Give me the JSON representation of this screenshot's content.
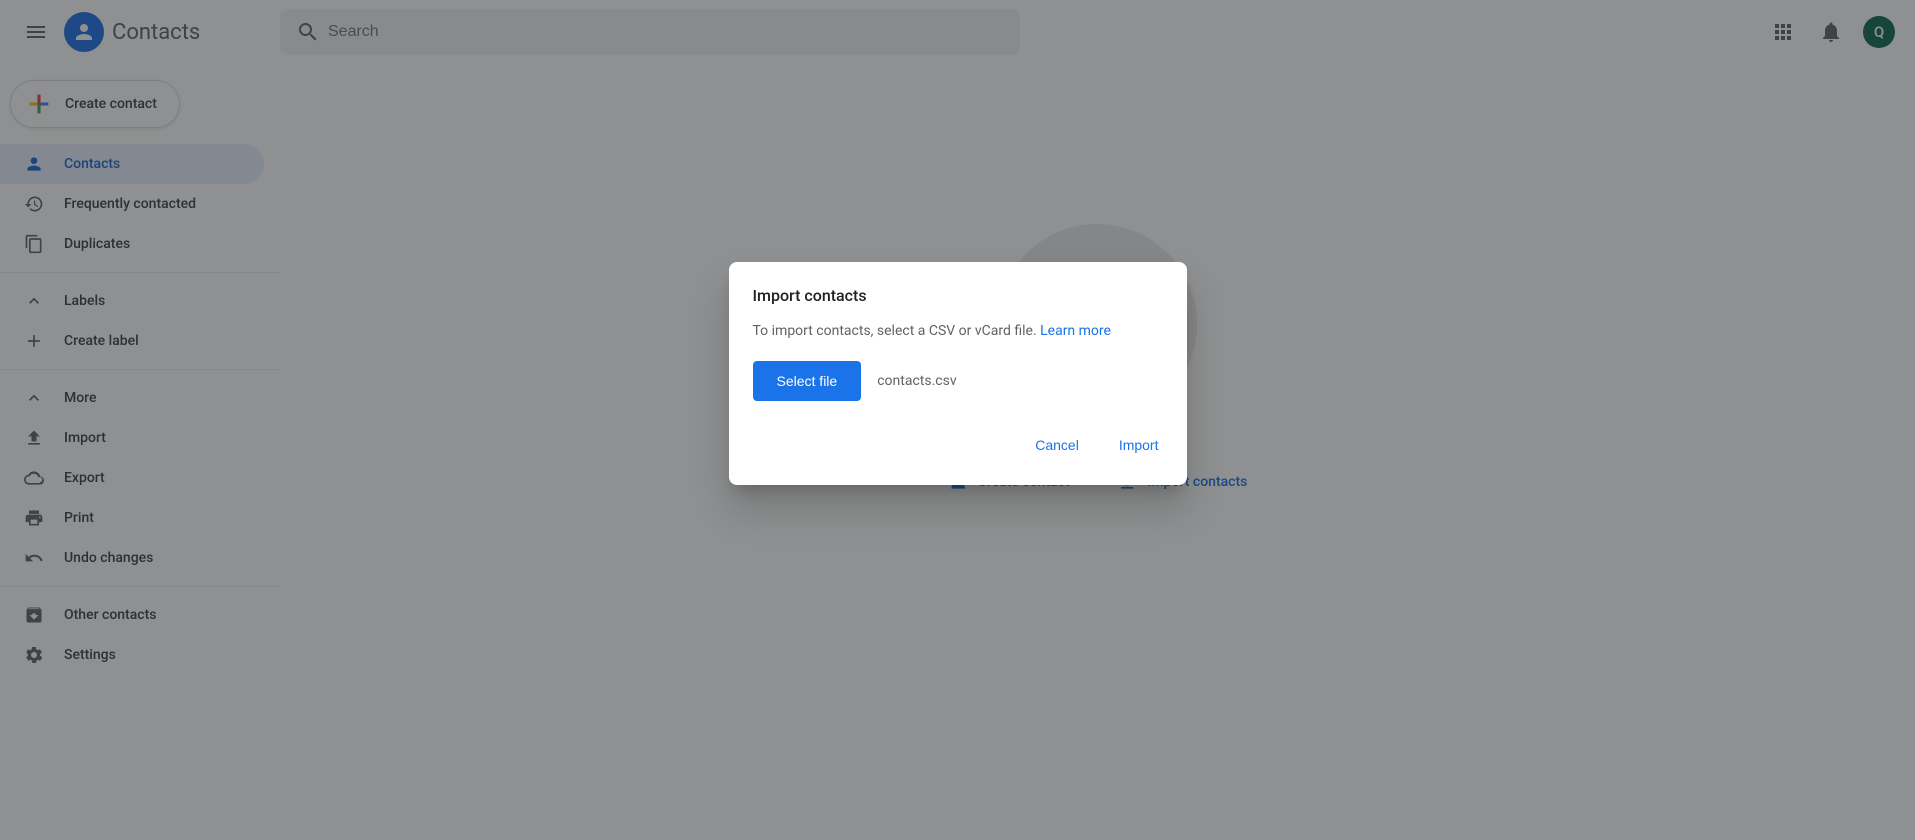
{
  "header": {
    "app_title": "Contacts",
    "search_placeholder": "Search",
    "avatar_initial": "Q"
  },
  "sidebar": {
    "create_label": "Create contact",
    "items": [
      {
        "label": "Contacts"
      },
      {
        "label": "Frequently contacted"
      },
      {
        "label": "Duplicates"
      }
    ],
    "labels_header": "Labels",
    "create_label_label": "Create label",
    "more_header": "More",
    "more_items": [
      {
        "label": "Import"
      },
      {
        "label": "Export"
      },
      {
        "label": "Print"
      },
      {
        "label": "Undo changes"
      }
    ],
    "other_items": [
      {
        "label": "Other contacts"
      },
      {
        "label": "Settings"
      }
    ]
  },
  "main": {
    "create_contact": "Create contact",
    "import_contacts": "Import contacts"
  },
  "dialog": {
    "title": "Import contacts",
    "text": "To import contacts, select a CSV or vCard file. ",
    "learn_more": "Learn more",
    "select_file": "Select file",
    "filename": "contacts.csv",
    "cancel": "Cancel",
    "import": "Import"
  }
}
